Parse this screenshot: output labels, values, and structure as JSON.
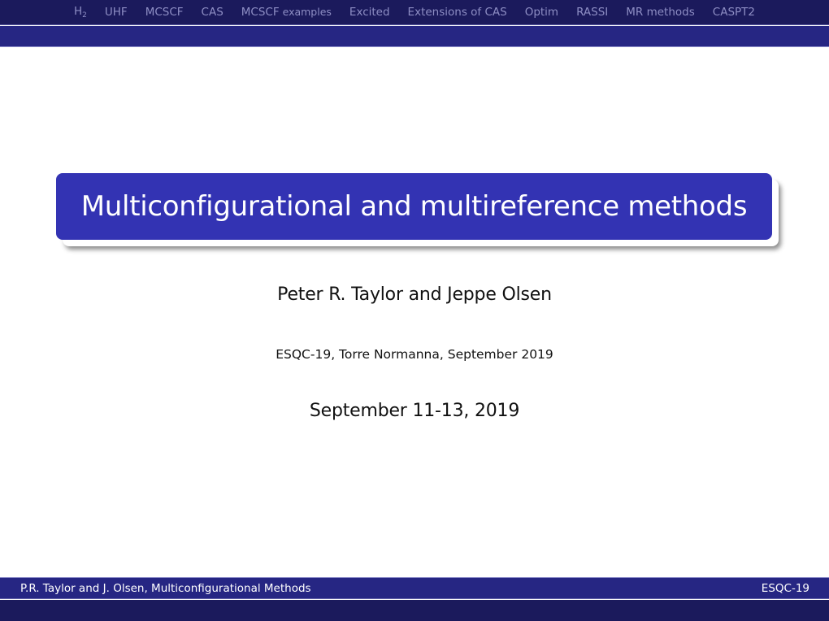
{
  "nav": {
    "items": [
      {
        "label": "H",
        "sub": "2"
      },
      {
        "label": "UHF"
      },
      {
        "label": "MCSCF"
      },
      {
        "label": "CAS"
      },
      {
        "label": "MCSCF",
        "suffix": " examples"
      },
      {
        "label": "Excited"
      },
      {
        "label": "Extensions of CAS"
      },
      {
        "label": "Optim"
      },
      {
        "label": "RASSI"
      },
      {
        "label": "MR methods"
      },
      {
        "label": "CASPT2"
      }
    ]
  },
  "title": {
    "text": "Multiconfigurational and multireference methods"
  },
  "author": "Peter R. Taylor and Jeppe Olsen",
  "institute": "ESQC-19, Torre Normanna, September 2019",
  "date": "September 11-13, 2019",
  "footer": {
    "left": "P.R. Taylor and J. Olsen, Multiconfigurational Methods",
    "right": "ESQC-19"
  },
  "colors": {
    "nav_bg": "#1b1a5c",
    "subbar_bg": "#262683",
    "title_box_bg": "#3333b3",
    "nav_text": "#8e8ec4"
  }
}
